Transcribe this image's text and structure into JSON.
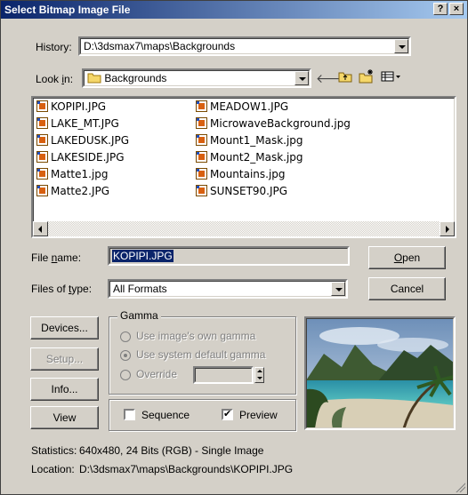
{
  "window": {
    "title": "Select Bitmap Image File",
    "help_label": "?",
    "close_label": "×"
  },
  "history": {
    "label_pre": "History: ",
    "value": "D:\\3dsmax7\\maps\\Backgrounds"
  },
  "lookin": {
    "label_pre": "Look ",
    "label_u": "i",
    "label_post": "n:",
    "value": "Backgrounds"
  },
  "toolbar": {
    "back_icon": "back-arrow-icon",
    "up_icon": "up-folder-icon",
    "new_icon": "new-folder-icon",
    "view_icon": "view-menu-icon"
  },
  "files": {
    "col1": [
      "KOPIPI.JPG",
      "LAKE_MT.JPG",
      "LAKEDUSK.JPG",
      "LAKESIDE.JPG",
      "Matte1.jpg",
      "Matte2.JPG"
    ],
    "col2": [
      "MEADOW1.JPG",
      "MicrowaveBackground.jpg",
      "Mount1_Mask.jpg",
      "Mount2_Mask.jpg",
      "Mountains.jpg",
      "SUNSET90.JPG"
    ]
  },
  "filename": {
    "label_pre": "File ",
    "label_u": "n",
    "label_post": "ame:",
    "value": "KOPIPI.JPG"
  },
  "filetype": {
    "label_pre": "Files of ",
    "label_u": "t",
    "label_post": "ype:",
    "value": "All Formats"
  },
  "buttons": {
    "open_u": "O",
    "open_rest": "pen",
    "cancel": "Cancel",
    "devices": "Devices...",
    "setup": "Setup...",
    "info": "Info...",
    "view": "View"
  },
  "gamma": {
    "title": "Gamma",
    "own": "Use image's own gamma",
    "system": "Use system default gamma",
    "override": "Override",
    "override_value": ""
  },
  "options": {
    "sequence": "Sequence",
    "preview": "Preview",
    "sequence_checked": false,
    "preview_checked": true
  },
  "statistics": {
    "label": "Statistics:",
    "value": "640x480, 24 Bits (RGB) - Single Image"
  },
  "location": {
    "label": "Location:",
    "value": "D:\\3dsmax7\\maps\\Backgrounds\\KOPIPI.JPG"
  },
  "colors": {
    "title_start": "#0a246a",
    "title_end": "#a6caf0",
    "selection": "#0a246a",
    "face": "#d4d0c8"
  }
}
